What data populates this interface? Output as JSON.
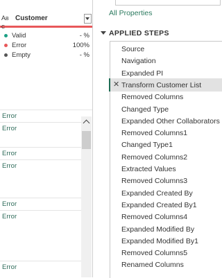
{
  "column": {
    "type_icon": "ABC",
    "title": "Customer",
    "stats": [
      {
        "label": "Valid",
        "value": "- %",
        "color": "#1ca085"
      },
      {
        "label": "Error",
        "value": "100%",
        "color": "#e8585a"
      },
      {
        "label": "Empty",
        "value": "- %",
        "color": "#555555"
      }
    ],
    "cells": [
      "Error",
      "Error",
      "Error",
      "Error",
      "Error",
      "Error",
      "Error"
    ]
  },
  "query_settings": {
    "all_properties_link": "All Properties",
    "steps_header": "APPLIED STEPS",
    "selected_index": 3,
    "steps": [
      "Source",
      "Navigation",
      "Expanded PI",
      "Transform Customer List",
      "Removed Columns",
      "Changed Type",
      "Expanded Other Collaborators",
      "Removed Columns1",
      "Changed Type1",
      "Removed Columns2",
      "Extracted Values",
      "Removed Columns3",
      "Expanded Created By",
      "Expanded Created By1",
      "Removed Columns4",
      "Expanded Modified By",
      "Expanded Modified By1",
      "Removed Columns5",
      "Renamed Columns"
    ],
    "delete_glyph": "✕"
  }
}
